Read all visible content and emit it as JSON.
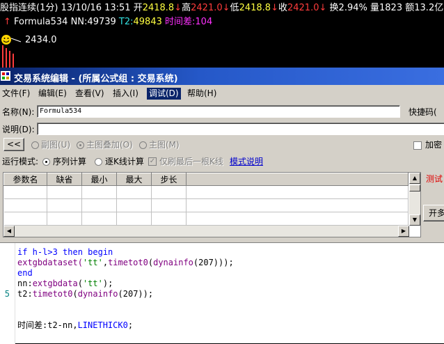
{
  "chart_header": {
    "name": "股指连续",
    "period": "(1分)",
    "datetime": "13/10/16 13:51",
    "open_label": "开",
    "open_value": "2418.8",
    "high_label": "高",
    "high_value": "2421.0",
    "low_label": "低",
    "low_value": "2418.8",
    "close_label": "收",
    "close_value": "2421.0",
    "change_label": "换",
    "change_value": "2.94%",
    "volume_label": "量",
    "volume_value": "1823",
    "amount_label": "额",
    "amount_value": "13.2亿"
  },
  "indicator_line": {
    "arrow": "↑",
    "formula_name": "Formula534",
    "nn_label": "NN:",
    "nn_value": "49739",
    "t2_label": "T2:",
    "t2_value": "49843",
    "diff_label": "时间差:",
    "diff_value": "104"
  },
  "price_marker": "2434.0",
  "window": {
    "title": "交易系统编辑 - (所属公式组 : 交易系统)"
  },
  "menu": [
    {
      "label": "文件(F)"
    },
    {
      "label": "编辑(E)"
    },
    {
      "label": "查看(V)"
    },
    {
      "label": "插入(I)"
    },
    {
      "label": "调试(D)",
      "active": true
    },
    {
      "label": "帮助(H)"
    }
  ],
  "form": {
    "name_label": "名称(N):",
    "name_value": "Formula534",
    "shortcut_label": "快捷码(",
    "desc_label": "说明(D):",
    "desc_value": "",
    "collapse_button": "<<",
    "subchart_label": "副图(U)",
    "overlay_label": "主图叠加(O)",
    "main_label": "主图(M)",
    "encrypt_label": "加密",
    "mode_label": "运行模式:",
    "mode_seq_label": "序列计算",
    "mode_line_label": "逐K线计算",
    "refresh_last_label": "仅刷最后一根K线",
    "mode_help_link": "模式说明",
    "test_label": "测试",
    "open_button": "开多"
  },
  "params_table": {
    "headers": [
      "参数名",
      "缺省",
      "最小",
      "最大",
      "步长"
    ],
    "rows": [
      [
        "",
        "",
        "",
        "",
        ""
      ],
      [
        "",
        "",
        "",
        "",
        ""
      ],
      [
        "",
        "",
        "",
        "",
        ""
      ]
    ]
  },
  "code": {
    "line_number": "5",
    "l1_a": "if h-l>3 ",
    "l1_b": "then begin",
    "l2_a": "extgbdataset(",
    "l2_b": "'tt'",
    "l2_c": ",",
    "l2_d": "timetot0",
    "l2_e": "(",
    "l2_f": "dynainfo",
    "l2_g": "(207)));",
    "l3": "end",
    "l4_a": "nn:",
    "l4_b": "extgbdata",
    "l4_c": "(",
    "l4_d": "'tt'",
    "l4_e": ");",
    "l5_a": "t2:",
    "l5_b": "timetot0",
    "l5_c": "(",
    "l5_d": "dynainfo",
    "l5_e": "(207));",
    "l7_a": "时间差:t2-nn,",
    "l7_b": "LINETHICK0",
    "l7_c": ";"
  }
}
